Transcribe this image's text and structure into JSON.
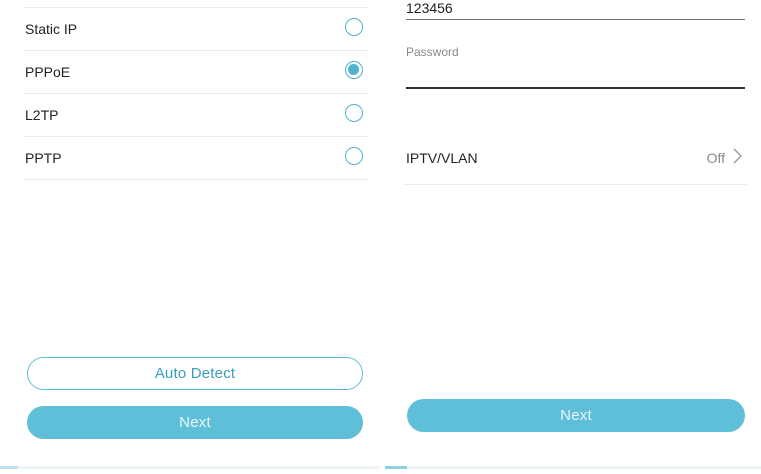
{
  "left_screen": {
    "options": [
      {
        "label": "Static IP",
        "selected": false
      },
      {
        "label": "PPPoE",
        "selected": true
      },
      {
        "label": "L2TP",
        "selected": false
      },
      {
        "label": "PPTP",
        "selected": false
      }
    ],
    "auto_detect_label": "Auto Detect",
    "next_label": "Next"
  },
  "right_screen": {
    "username_value": "123456",
    "password_placeholder": "Password",
    "password_value": "",
    "iptv": {
      "label": "IPTV/VLAN",
      "value": "Off"
    },
    "next_label": "Next"
  },
  "colors": {
    "accent": "#4fb3cf",
    "button_fill": "#5fbfd8",
    "divider": "#ececec"
  },
  "icons": {
    "radio_unselected": "radio-empty-icon",
    "radio_selected": "radio-filled-icon",
    "chevron": "chevron-right-icon"
  }
}
